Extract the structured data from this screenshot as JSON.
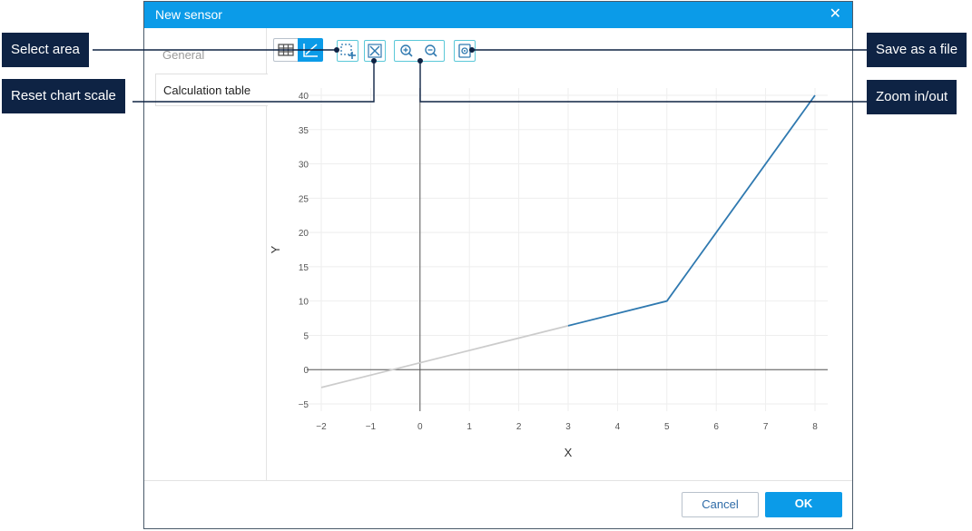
{
  "dialog": {
    "title": "New sensor",
    "close_icon": "close-icon",
    "tabs": [
      {
        "label": "General",
        "active": false
      },
      {
        "label": "Calculation table",
        "active": true
      }
    ],
    "buttons": {
      "cancel": "Cancel",
      "ok": "OK"
    }
  },
  "toolbar": {
    "icons": [
      "table-view-icon",
      "chart-view-icon",
      "select-area-icon",
      "reset-scale-icon",
      "zoom-in-icon",
      "zoom-out-icon",
      "save-file-icon"
    ]
  },
  "callouts": {
    "select_area": "Select area",
    "reset_scale": "Reset chart scale",
    "save_file": "Save as a file",
    "zoom": "Zoom in/out"
  },
  "colors": {
    "accent": "#0b9be8",
    "callout_bg": "#0e2344",
    "series_active": "#2f79b0",
    "series_inactive": "#cccccc",
    "tool_border": "#5bc8d8"
  },
  "chart_data": {
    "type": "line",
    "xlabel": "X",
    "ylabel": "Y",
    "xlim": [
      -2,
      8
    ],
    "ylim": [
      -5,
      40
    ],
    "x_ticks": [
      -2,
      -1,
      0,
      1,
      2,
      3,
      4,
      5,
      6,
      7,
      8
    ],
    "y_ticks": [
      -5,
      0,
      5,
      10,
      15,
      20,
      25,
      30,
      35,
      40
    ],
    "grid": true,
    "series": [
      {
        "points": [
          [
            -2,
            -2.6
          ],
          [
            3,
            6.4
          ]
        ],
        "style": "inactive"
      },
      {
        "points": [
          [
            3,
            6.4
          ],
          [
            5,
            10
          ],
          [
            8,
            40
          ]
        ],
        "style": "active"
      }
    ]
  }
}
